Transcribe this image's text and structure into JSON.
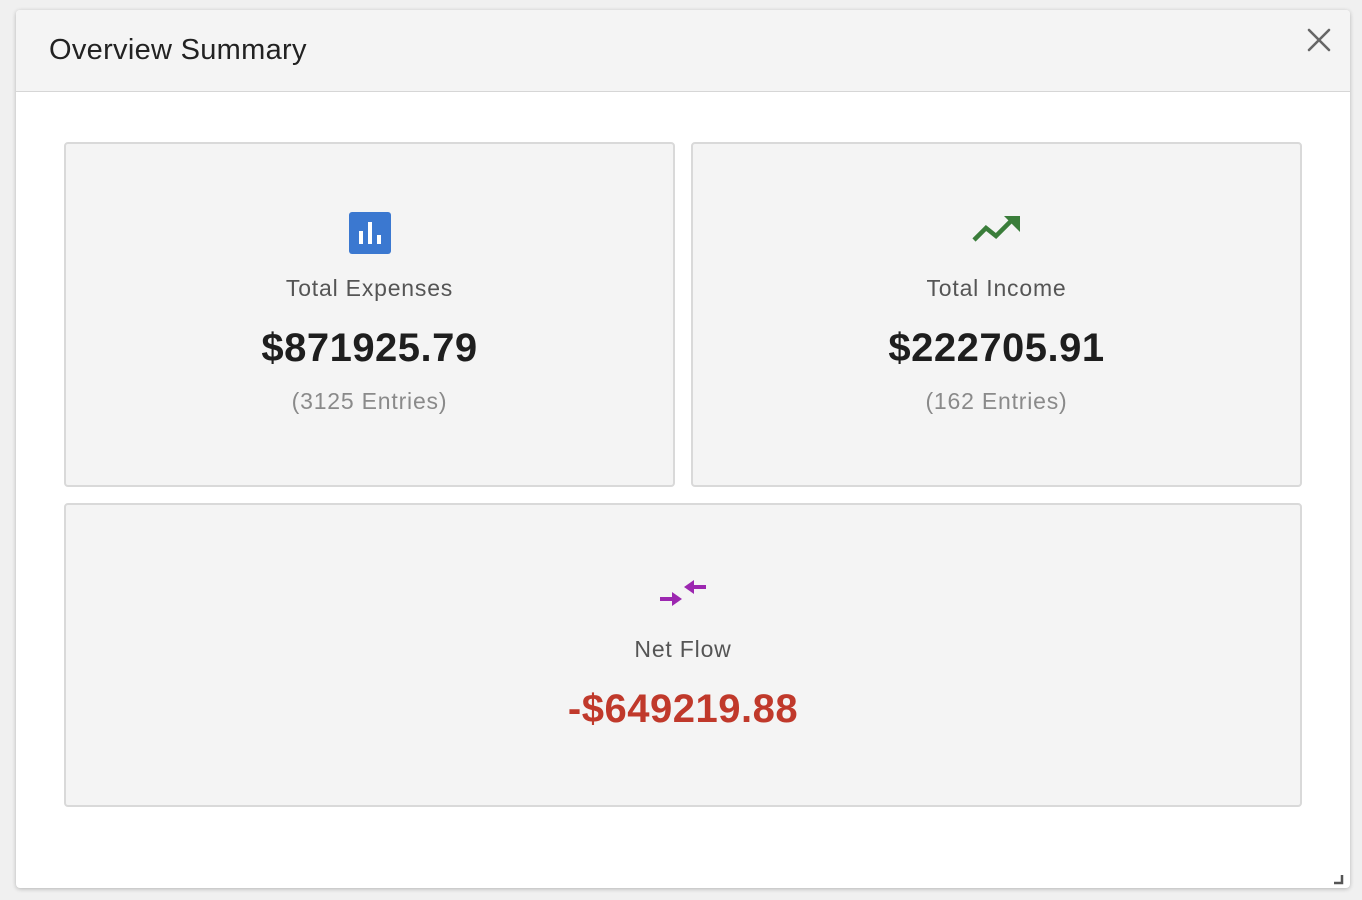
{
  "dialog": {
    "title": "Overview Summary",
    "close_icon": "close-icon"
  },
  "cards": {
    "expenses": {
      "icon": "bar-chart-icon",
      "icon_color": "#3b78d0",
      "label": "Total Expenses",
      "value": "$871925.79",
      "entries": "(3125 Entries)"
    },
    "income": {
      "icon": "trending-up-icon",
      "icon_color": "#3a7d3a",
      "label": "Total Income",
      "value": "$222705.91",
      "entries": "(162 Entries)"
    },
    "net": {
      "icon": "compare-arrows-icon",
      "icon_color": "#9c27b0",
      "label": "Net Flow",
      "value": "-$649219.88",
      "value_color": "#c0392b"
    }
  },
  "colors": {
    "header_bg": "#f4f4f4",
    "card_bg": "#f4f4f4",
    "negative": "#c0392b"
  }
}
